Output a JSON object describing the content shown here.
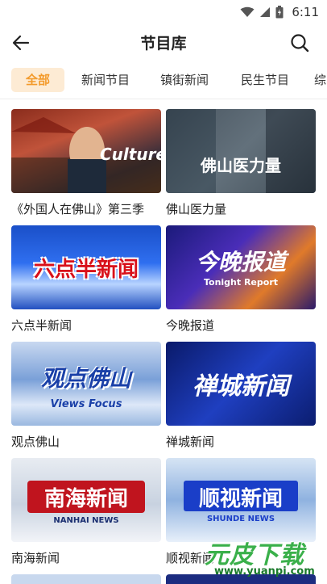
{
  "status_bar": {
    "time": "6:11",
    "icons": [
      "wifi-icon",
      "signal-icon",
      "battery-icon"
    ]
  },
  "header": {
    "title": "节目库",
    "back_icon": "back-arrow-icon",
    "search_icon": "search-icon"
  },
  "tabs": [
    {
      "label": "全部",
      "active": true
    },
    {
      "label": "新闻节目",
      "active": false
    },
    {
      "label": "镇街新闻",
      "active": false
    },
    {
      "label": "民生节目",
      "active": false
    },
    {
      "label": "综",
      "active": false
    }
  ],
  "programs": [
    {
      "title": "《外国人在佛山》第三季",
      "thumb_text": "Culture",
      "thumb_sub": ""
    },
    {
      "title": "佛山医力量",
      "thumb_text": "佛山医力量",
      "thumb_sub": ""
    },
    {
      "title": "六点半新闻",
      "thumb_text": "六点半新闻",
      "thumb_sub": ""
    },
    {
      "title": "今晚报道",
      "thumb_text": "今晚报道",
      "thumb_sub": "Tonight Report"
    },
    {
      "title": "观点佛山",
      "thumb_text": "观点佛山",
      "thumb_sub": "Views Focus"
    },
    {
      "title": "禅城新闻",
      "thumb_text": "禅城新闻",
      "thumb_sub": ""
    },
    {
      "title": "南海新闻",
      "thumb_text": "南海新闻",
      "thumb_sub": "NANHAI NEWS"
    },
    {
      "title": "顺视新闻",
      "thumb_text": "顺视新闻",
      "thumb_sub": "SHUNDE NEWS"
    }
  ],
  "watermark": {
    "text": "元皮下载",
    "url": "www.yuanpi.com"
  },
  "colors": {
    "accent": "#f39a2b",
    "accent_bg": "#fdebd4"
  }
}
